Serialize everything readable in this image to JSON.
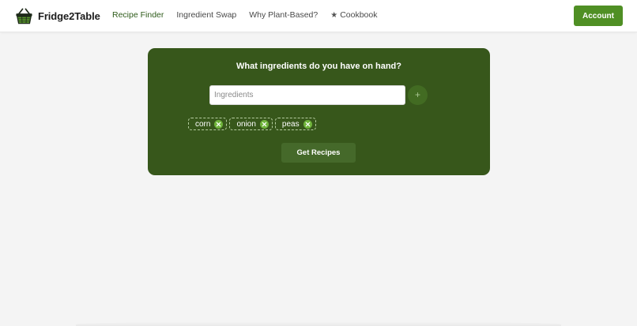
{
  "brand": {
    "name": "Fridge2Table",
    "logo_icon": "basket-icon"
  },
  "nav": {
    "links": [
      {
        "label": "Recipe Finder",
        "active": true
      },
      {
        "label": "Ingredient Swap",
        "active": false
      },
      {
        "label": "Why Plant-Based?",
        "active": false
      },
      {
        "label": "Cookbook",
        "icon": "star-icon",
        "active": false
      }
    ],
    "account_label": "Account"
  },
  "finder": {
    "title": "What ingredients do you have on hand?",
    "input_value": "",
    "input_placeholder": "Ingredients",
    "add_symbol": "+",
    "chips": [
      {
        "label": "corn"
      },
      {
        "label": "onion"
      },
      {
        "label": "peas"
      }
    ],
    "submit_label": "Get Recipes"
  },
  "colors": {
    "card_bg": "#37571b",
    "accent": "#4f8f24",
    "chip_remove": "#6fb43a",
    "active_nav": "#2e5b1a",
    "page_bg": "#f4f4f4"
  }
}
